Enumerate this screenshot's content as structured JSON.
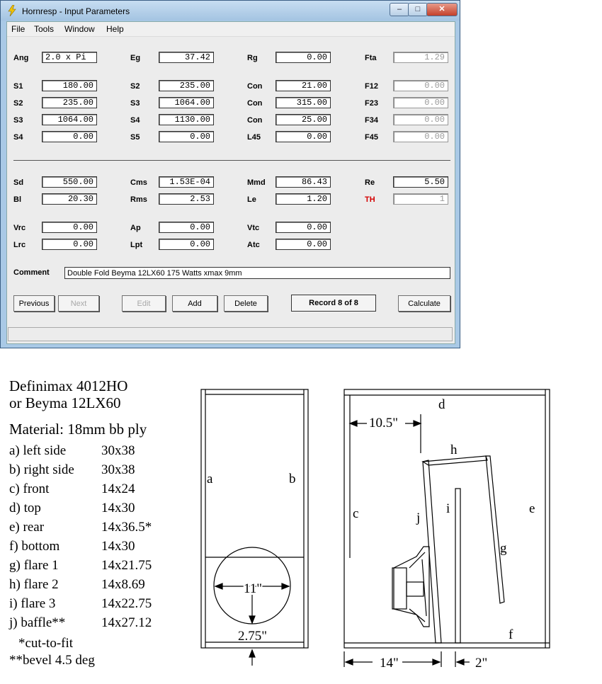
{
  "window": {
    "title": "Hornresp - Input Parameters",
    "controls": {
      "minimize": "–",
      "maximize": "□",
      "close": "✕"
    }
  },
  "menu": [
    "File",
    "Tools",
    "Window",
    "Help"
  ],
  "params": {
    "Ang": "2.0 x Pi",
    "Eg": "37.42",
    "Rg": "0.00",
    "Fta": "1.29",
    "S1": "180.00",
    "S2a": "235.00",
    "Con1": "21.00",
    "F12": "0.00",
    "S2": "235.00",
    "S3a": "1064.00",
    "Con2": "315.00",
    "F23": "0.00",
    "S3": "1064.00",
    "S4a": "1130.00",
    "Con3": "25.00",
    "F34": "0.00",
    "S4": "0.00",
    "S5": "0.00",
    "L45": "0.00",
    "F45": "0.00",
    "Sd": "550.00",
    "Cms": "1.53E-04",
    "Mmd": "86.43",
    "Re": "5.50",
    "Bl": "20.30",
    "Rms": "2.53",
    "Le": "1.20",
    "TH": "1",
    "Vrc": "0.00",
    "Ap": "0.00",
    "Vtc": "0.00",
    "Lrc": "0.00",
    "Lpt": "0.00",
    "Atc": "0.00"
  },
  "labels": {
    "Ang": "Ang",
    "Eg": "Eg",
    "Rg": "Rg",
    "Fta": "Fta",
    "S1": "S1",
    "S2": "S2",
    "S3": "S3",
    "S4": "S4",
    "S5": "S5",
    "Con": "Con",
    "L45": "L45",
    "F12": "F12",
    "F23": "F23",
    "F34": "F34",
    "F45": "F45",
    "Sd": "Sd",
    "Cms": "Cms",
    "Mmd": "Mmd",
    "Re": "Re",
    "Bl": "Bl",
    "Rms": "Rms",
    "Le": "Le",
    "TH": "TH",
    "Vrc": "Vrc",
    "Ap": "Ap",
    "Vtc": "Vtc",
    "Lrc": "Lrc",
    "Lpt": "Lpt",
    "Atc": "Atc",
    "Comment": "Comment"
  },
  "comment": "Double Fold Beyma 12LX60 175 Watts xmax 9mm",
  "buttons": {
    "previous": "Previous",
    "next": "Next",
    "edit": "Edit",
    "add": "Add",
    "delete": "Delete",
    "calculate": "Calculate"
  },
  "record": "Record 8 of 8",
  "cutlist": {
    "driver1": "Definimax 4012HO",
    "driver2": "or Beyma 12LX60",
    "material": "Material: 18mm bb ply",
    "items": [
      {
        "name": "a) left side",
        "dim": "30x38"
      },
      {
        "name": "b) right side",
        "dim": "30x38"
      },
      {
        "name": "c) front",
        "dim": "14x24"
      },
      {
        "name": "d) top",
        "dim": "14x30"
      },
      {
        "name": "e) rear",
        "dim": "14x36.5*"
      },
      {
        "name": "f)  bottom",
        "dim": "14x30"
      },
      {
        "name": "g) flare 1",
        "dim": "14x21.75"
      },
      {
        "name": "h) flare 2",
        "dim": "14x8.69"
      },
      {
        "name": "i)  flare 3",
        "dim": "14x22.75"
      },
      {
        "name": "j)  baffle**",
        "dim": "14x27.12"
      }
    ],
    "note1": "*cut-to-fit",
    "note2": "**bevel 4.5 deg"
  },
  "front_view": {
    "a": "a",
    "b": "b",
    "width_label": "11\"",
    "offset_label": "2.75\""
  },
  "side_view": {
    "d": "d",
    "h": "h",
    "i": "i",
    "c": "c",
    "j": "j",
    "e": "e",
    "g": "g",
    "f": "f",
    "top_dim": "10.5\"",
    "bottom_dim": "14\"",
    "gap_dim": "2\""
  }
}
